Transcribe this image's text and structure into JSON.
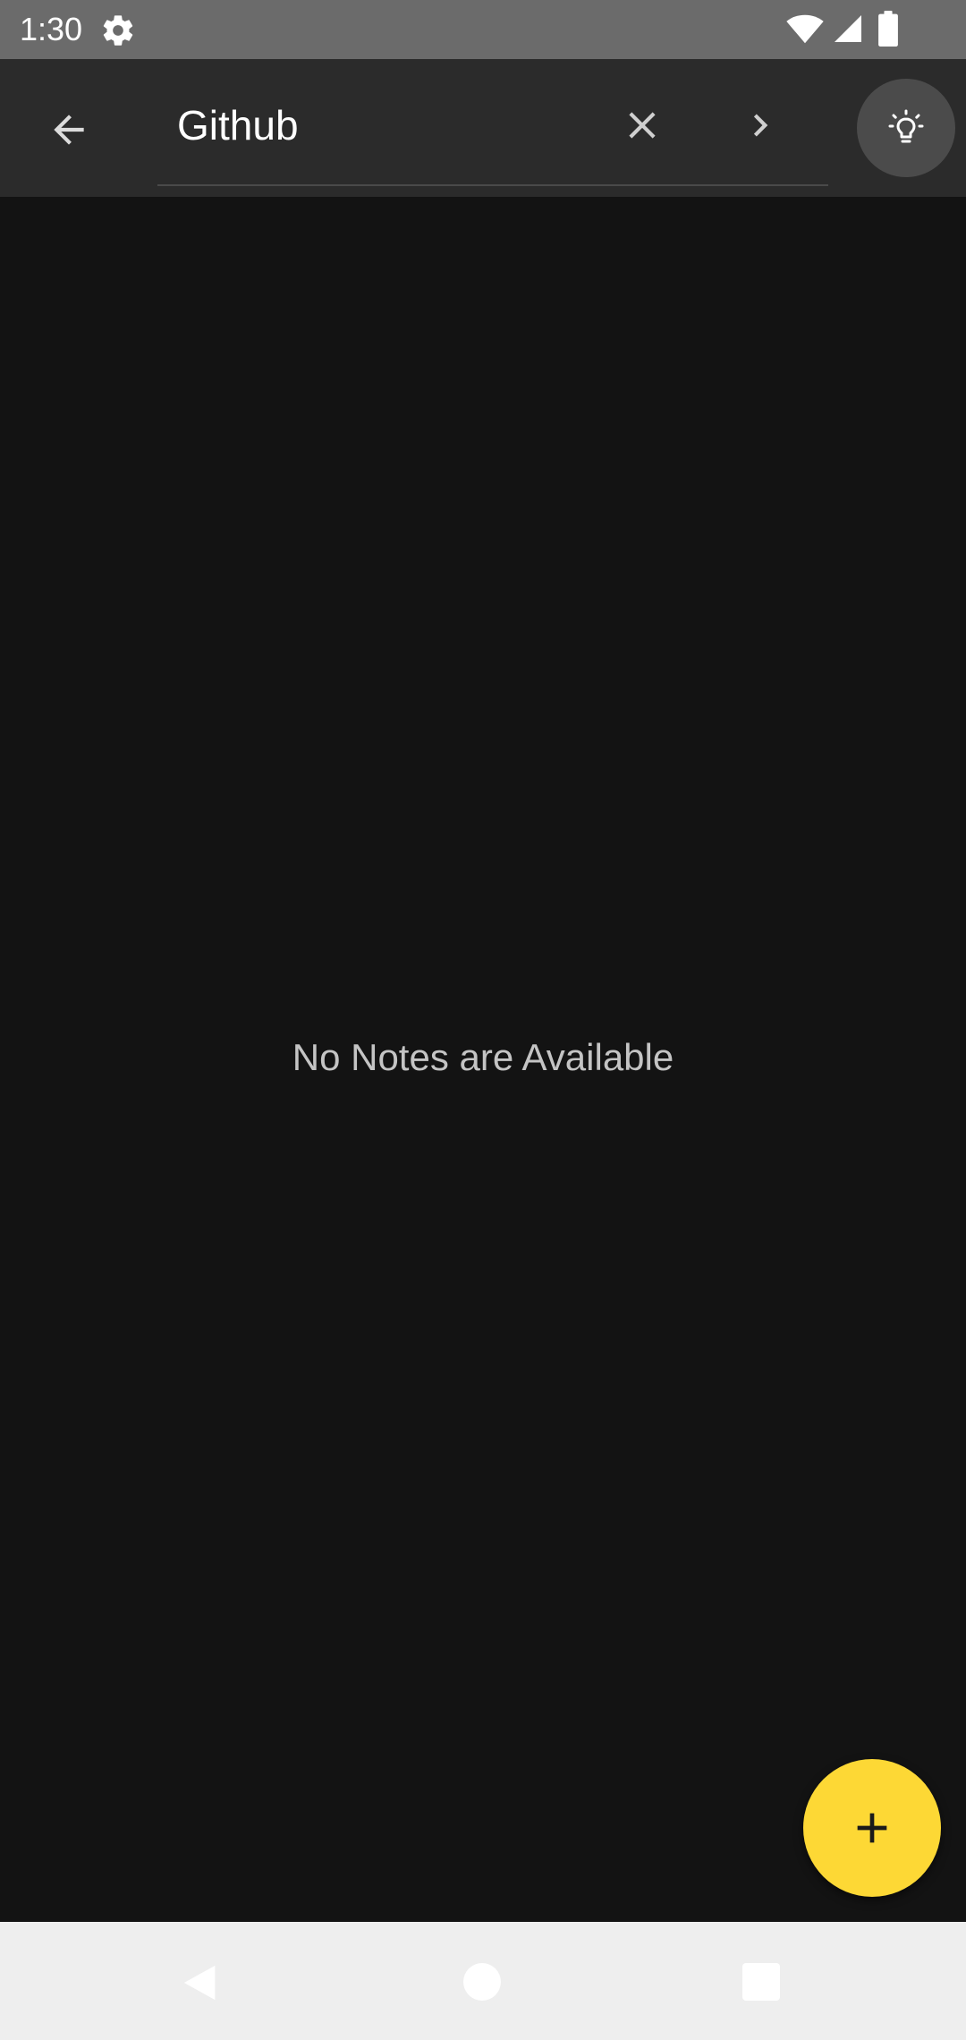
{
  "status_bar": {
    "time": "1:30",
    "icons": [
      "gear-icon",
      "wifi-icon",
      "signal-icon",
      "battery-icon"
    ]
  },
  "app_bar": {
    "back_icon": "arrow-back-icon",
    "search": {
      "value": "Github"
    },
    "clear_icon": "close-icon",
    "next_icon": "chevron-right-icon",
    "idea_icon": "lightbulb-icon"
  },
  "content": {
    "empty_message": "No Notes are Available"
  },
  "fab": {
    "icon": "plus-icon",
    "color": "#fdd835"
  },
  "nav_bar": {
    "icons": [
      "nav-back-icon",
      "nav-home-icon",
      "nav-recents-icon"
    ]
  },
  "colors": {
    "status_bar": "#6b6b6b",
    "app_bar": "#2b2b2b",
    "background": "#131313",
    "accent": "#fdd835",
    "nav_bar": "#eeeeee"
  }
}
